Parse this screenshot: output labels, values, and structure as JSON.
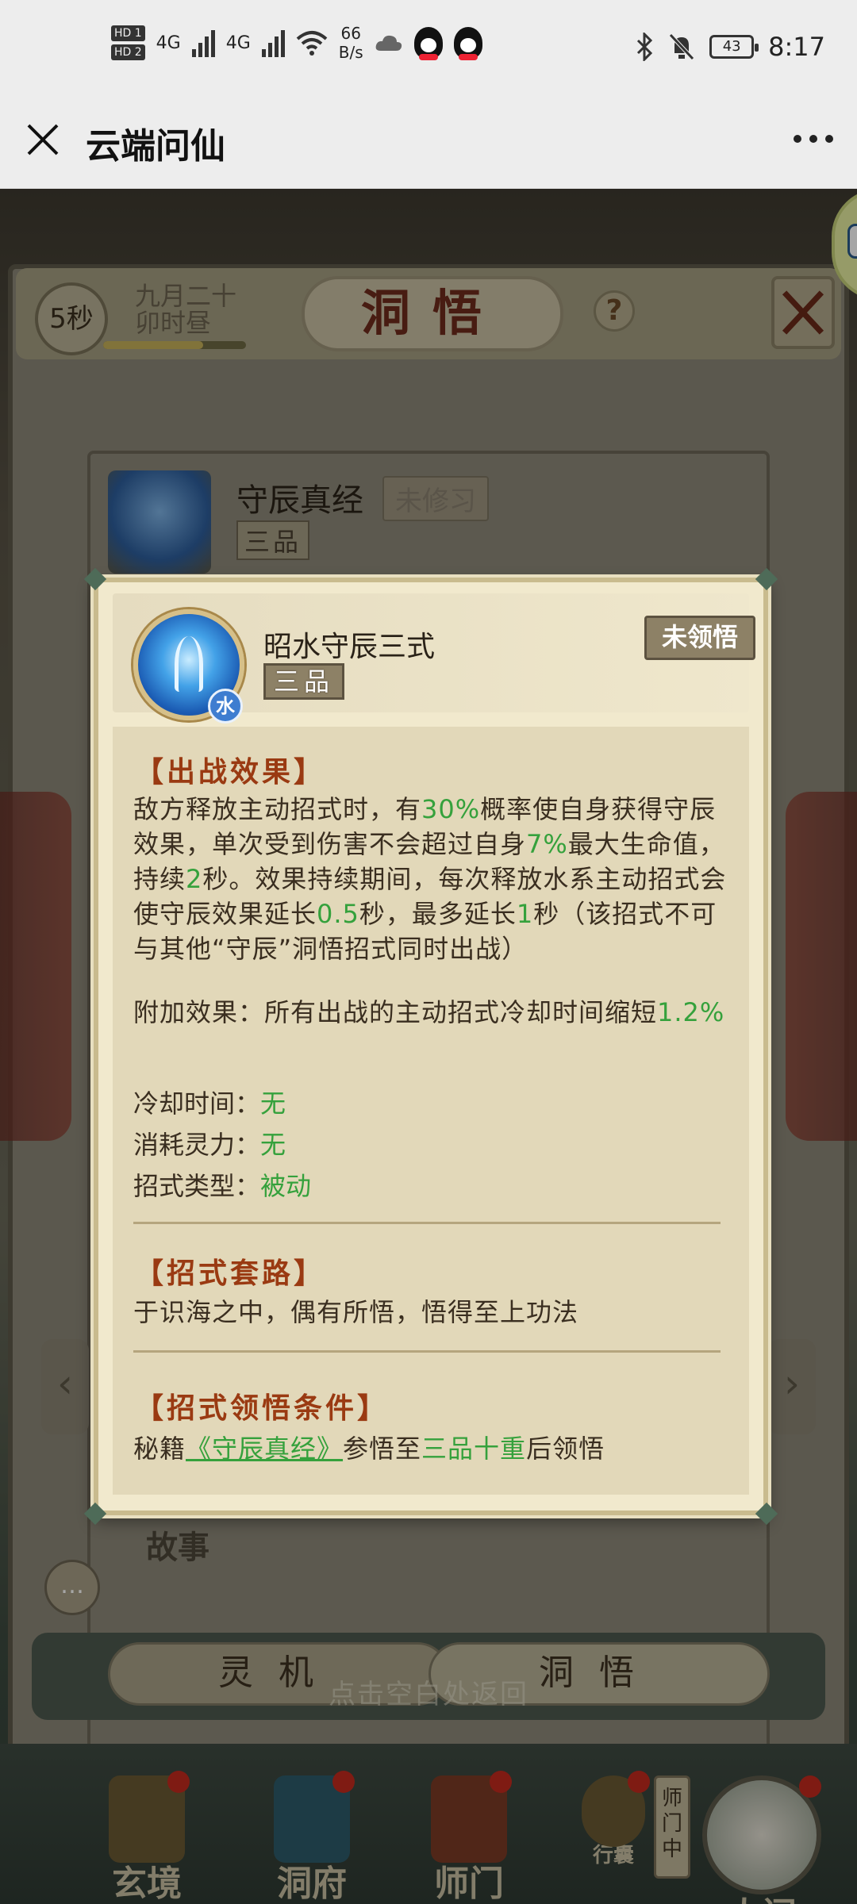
{
  "status_bar": {
    "sim1": "HD 1",
    "sim2": "HD 2",
    "net1": "4G",
    "net2": "4G",
    "speed_value": "66",
    "speed_unit": "B/s",
    "battery": "43",
    "time": "8:17"
  },
  "app_bar": {
    "title": "云端问仙"
  },
  "game": {
    "timer": "5秒",
    "date_line1": "九月二十",
    "date_line2": "卯时昼",
    "date_progress": 0.7,
    "page_title": "洞悟",
    "help": "?",
    "book": {
      "title": "守辰真经",
      "status": "未修习",
      "grade": "三品"
    },
    "story_label": "故事",
    "tabs": [
      "灵机",
      "洞悟"
    ],
    "hint": "点击空白处返回",
    "nav": [
      "玄境",
      "洞府",
      "师门",
      "行囊",
      "人间"
    ],
    "shimen_tag": "师门中"
  },
  "popup": {
    "skill_name": "昭水守辰三式",
    "grade": "三品",
    "element": "水",
    "status": "未领悟",
    "battle_effect": {
      "title": "【出战效果】",
      "p1_a": "敌方释放主动招式时，有",
      "p1_v1": "30%",
      "p1_b": "概率使自身获得守辰效果，单次受到伤害不会超过自身",
      "p1_v2": "7%",
      "p1_c": "最大生命值，持续",
      "p1_v3": "2",
      "p1_d": "秒。效果持续期间，每次释放水系主动招式会使守辰效果延长",
      "p1_v4": "0.5",
      "p1_e": "秒，最多延长",
      "p1_v5": "1",
      "p1_f": "秒（该招式不可与其他“守辰”洞悟招式同时出战）",
      "extra_label": "附加效果：所有出战的主动招式冷却时间缩短",
      "extra_value": "1.2%"
    },
    "stats": [
      {
        "label": "冷却时间：",
        "value": "无"
      },
      {
        "label": "消耗灵力：",
        "value": "无"
      },
      {
        "label": "招式类型：",
        "value": "被动"
      }
    ],
    "routine": {
      "title": "【招式套路】",
      "text": "于识海之中，偶有所悟，悟得至上功法"
    },
    "condition": {
      "title": "【招式领悟条件】",
      "prefix": "秘籍",
      "book": "《守辰真经》",
      "middle": "参悟至",
      "level": "三品十重",
      "suffix": "后领悟"
    }
  },
  "colors": {
    "highlight_green": "#35a13c",
    "section_title": "#9a3a12",
    "popup_bg": "#f1e9cd"
  }
}
